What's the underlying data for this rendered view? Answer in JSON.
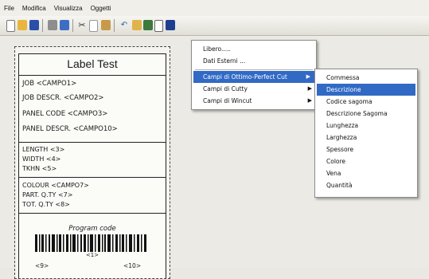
{
  "menubar": {
    "items": [
      "File",
      "Modifica",
      "Visualizza",
      "Oggetti"
    ]
  },
  "toolbar": {
    "icons": [
      "new-file-icon",
      "open-folder-icon",
      "save-icon",
      "print-icon",
      "print-preview-icon",
      "cut-icon",
      "copy-icon",
      "paste-icon",
      "undo-icon",
      "text-tool-icon",
      "image-tool-icon",
      "barcode-tool-icon",
      "field-tool-icon"
    ]
  },
  "label": {
    "title": "Label Test",
    "job": "JOB  <CAMPO1>",
    "job_descr": "JOB DESCR.  <CAMPO2>",
    "panel_code": "PANEL CODE  <CAMPO3>",
    "panel_descr": "PANEL DESCR.  <CAMPO10>",
    "length": "LENGTH  <3>",
    "width": "WIDTH  <4>",
    "tkhn": "TKHN  <5>",
    "colour": "COLOUR  <CAMPO7>",
    "part_qty": "PART. Q.TY  <7>",
    "tot_qty": "TOT. Q.TY  <8>",
    "program_code": "Program code",
    "barcode_text": "<1>",
    "field9": "<9>",
    "field10": "<10>"
  },
  "context_menu": {
    "items": [
      "Libero.....",
      "Dati Esterni ...",
      "Campi di Ottimo-Perfect Cut",
      "Campi di Cutty",
      "Campi di Wincut"
    ],
    "highlighted": "Campi di Ottimo-Perfect Cut"
  },
  "submenu": {
    "items": [
      "Commessa",
      "Descrizione",
      "Codice sagoma",
      "Descrizione Sagoma",
      "Lunghezza",
      "Larghezza",
      "Spessore",
      "Colore",
      "Vena",
      "Quantità"
    ],
    "highlighted": "Descrizione"
  },
  "colors": {
    "highlight": "#316ac5",
    "menu_bg": "#ffffff",
    "app_bg": "#eae8e2"
  }
}
